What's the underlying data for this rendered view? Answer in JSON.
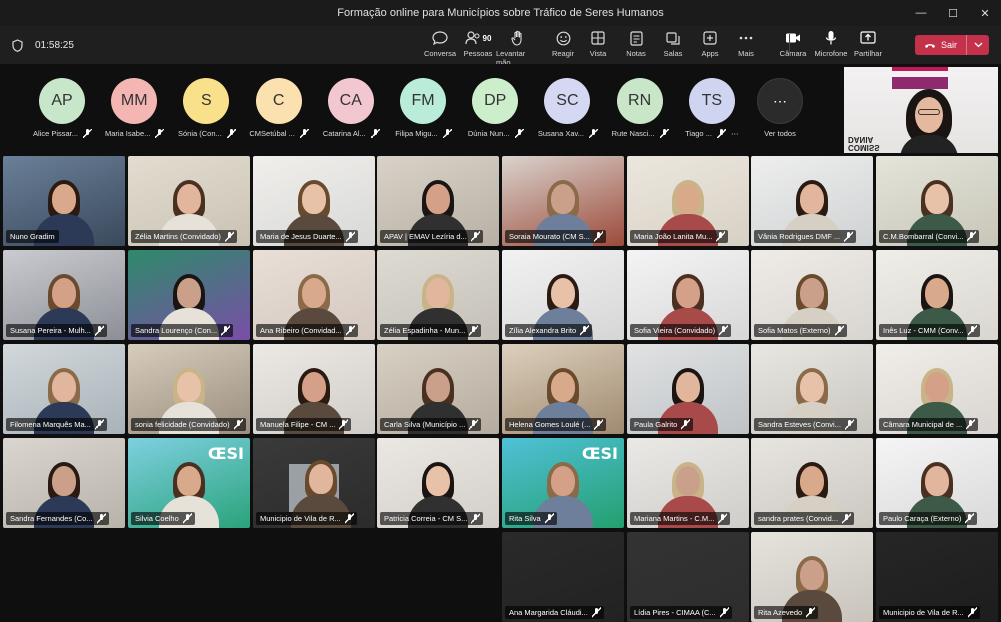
{
  "window": {
    "title": "Formação online para Municípios sobre Tráfico de Seres Humanos"
  },
  "toolbar": {
    "timer": "01:58:25",
    "buttons": [
      {
        "id": "chat",
        "label": "Conversa",
        "icon": "chat-icon"
      },
      {
        "id": "people",
        "label": "Pessoas",
        "icon": "people-icon",
        "count": "90"
      },
      {
        "id": "raise",
        "label": "Levantar mão",
        "icon": "hand-icon"
      },
      {
        "id": "react",
        "label": "Reagir",
        "icon": "smile-icon"
      },
      {
        "id": "view",
        "label": "Vista",
        "icon": "grid-icon"
      },
      {
        "id": "notes",
        "label": "Notas",
        "icon": "notes-icon"
      },
      {
        "id": "rooms",
        "label": "Salas",
        "icon": "rooms-icon"
      },
      {
        "id": "apps",
        "label": "Apps",
        "icon": "plus-icon"
      },
      {
        "id": "more",
        "label": "Mais",
        "icon": "more-icon"
      },
      {
        "id": "camera",
        "label": "Câmara",
        "icon": "camera-icon"
      },
      {
        "id": "mic",
        "label": "Microfone",
        "icon": "mic-icon"
      },
      {
        "id": "share",
        "label": "Partilhar",
        "icon": "share-icon"
      }
    ],
    "leave_label": "Sair"
  },
  "roster": {
    "avatars": [
      {
        "initials": "AP",
        "name": "Alice Pissar...",
        "color": "#c8e6c9",
        "muted": true
      },
      {
        "initials": "MM",
        "name": "Maria Isabe...",
        "color": "#f4b6b2",
        "muted": true
      },
      {
        "initials": "S",
        "name": "Sónia (Con...",
        "color": "#f9e08a",
        "muted": true
      },
      {
        "initials": "C",
        "name": "CMSetúbal ...",
        "color": "#fbe0b0",
        "muted": true
      },
      {
        "initials": "CA",
        "name": "Catarina Al...",
        "color": "#f2c7cf",
        "muted": true
      },
      {
        "initials": "FM",
        "name": "Filipa Migu...",
        "color": "#b9ecd9",
        "muted": true
      },
      {
        "initials": "DP",
        "name": "Dúnia Nun...",
        "color": "#cdeecb",
        "muted": true
      },
      {
        "initials": "SC",
        "name": "Susana Xav...",
        "color": "#d5d8f2",
        "muted": true
      },
      {
        "initials": "RN",
        "name": "Rute Nasci...",
        "color": "#c9e6c9",
        "muted": true
      },
      {
        "initials": "TS",
        "name": "Tiago ...",
        "color": "#cfd5f0",
        "muted": true
      }
    ],
    "see_all": "Ver todos"
  },
  "selfview": {
    "logo_text": "COMISS\nDANIA\nEAO"
  },
  "tiles": [
    {
      "name": "Nuno Gradim",
      "muted": false
    },
    {
      "name": "Zélia Martins (Convidado)",
      "muted": true
    },
    {
      "name": "Maria de Jesus Duarte...",
      "muted": true
    },
    {
      "name": "APAV | EMAV Lezíria d...",
      "muted": true
    },
    {
      "name": "Soraia Mourato (CM S...",
      "muted": true
    },
    {
      "name": "Maria João Lanita Mu...",
      "muted": true
    },
    {
      "name": "Vânia Rodrigues DMF ...",
      "muted": true
    },
    {
      "name": "C.M.Bombarral (Convi...",
      "muted": true
    },
    {
      "name": "Susana Pereira - Mulh...",
      "muted": true
    },
    {
      "name": "Sandra Lourenço (Con...",
      "muted": true
    },
    {
      "name": "Ana Ribeiro (Convidad...",
      "muted": true
    },
    {
      "name": "Zélia Espadinha - Mun...",
      "muted": true
    },
    {
      "name": "Zília Alexandra Brito",
      "muted": true
    },
    {
      "name": "Sofia Vieira (Convidado)",
      "muted": true
    },
    {
      "name": "Sofia Matos (Externo)",
      "muted": true
    },
    {
      "name": "Inês Luz - CMM (Conv...",
      "muted": true
    },
    {
      "name": "Filomena Marquês Ma...",
      "muted": true
    },
    {
      "name": "sonia felicidade (Convidado)",
      "muted": true
    },
    {
      "name": "Manuela Filipe - CM ...",
      "muted": true
    },
    {
      "name": "Carla Silva (Município ...",
      "muted": true
    },
    {
      "name": "Helena Gomes Loulé (...",
      "muted": true
    },
    {
      "name": "Paula Galrito",
      "muted": true
    },
    {
      "name": "Sandra Esteves (Convi...",
      "muted": true
    },
    {
      "name": "Câmara Municipal de ...",
      "muted": true
    },
    {
      "name": "Sandra Fernandes (Co...",
      "muted": true
    },
    {
      "name": "Silvia Coelho",
      "muted": true
    },
    {
      "name": "Municipio de Vila de R...",
      "muted": true
    },
    {
      "name": "Patricia Correia - CM S...",
      "muted": true
    },
    {
      "name": "Rita Silva",
      "muted": true
    },
    {
      "name": "Mariana Martins - C.M...",
      "muted": true
    },
    {
      "name": "sandra prates (Convid...",
      "muted": true
    },
    {
      "name": "Paulo Caraça (Externo)",
      "muted": true
    },
    {
      "name": "Ana Margarida Cláudi...",
      "muted": true
    },
    {
      "name": "Lídia Pires - CIMAA (C...",
      "muted": true
    },
    {
      "name": "Rita Azevedo",
      "muted": true
    },
    {
      "name": "Municipio de Vila de R...",
      "muted": true
    }
  ]
}
